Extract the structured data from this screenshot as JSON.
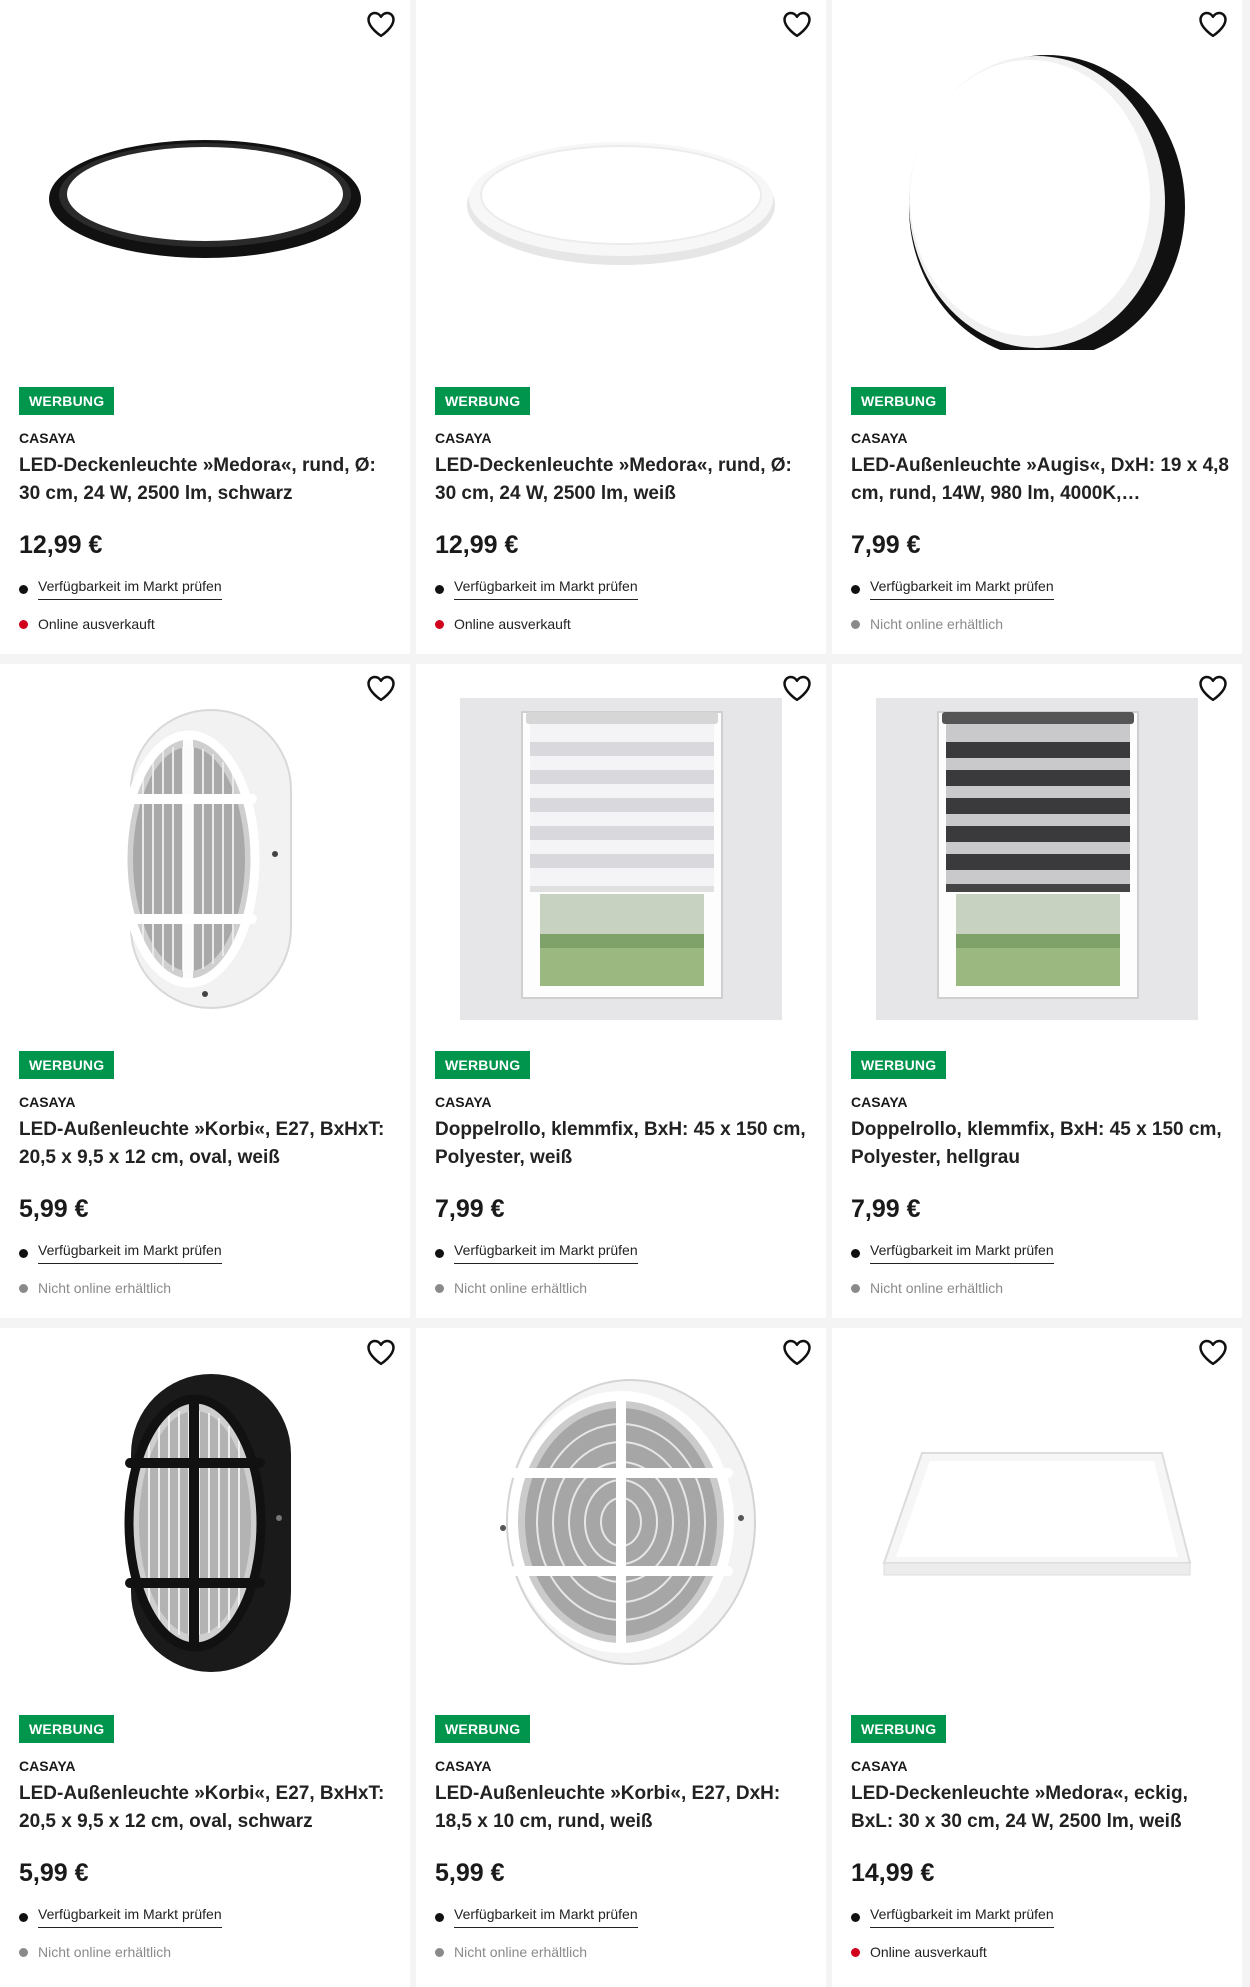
{
  "badge_label": "WERBUNG",
  "availability_link": "Verfügbarkeit im Markt prüfen",
  "colors": {
    "badge": "#00954d",
    "sold_out_dot": "#d0021b",
    "unavailable_dot": "#8a8a8a"
  },
  "products": [
    {
      "brand": "CASAYA",
      "title": "LED-Deckenleuchte »Medora«, rund, Ø: 30 cm, 24 W, 2500 lm, schwarz",
      "price": "12,99 €",
      "stock": "Online ausverkauft",
      "stock_status": "sold-out",
      "image": "round-ceiling-light-black"
    },
    {
      "brand": "CASAYA",
      "title": "LED-Deckenleuchte »Medora«, rund, Ø: 30 cm, 24 W, 2500 lm, weiß",
      "price": "12,99 €",
      "stock": "Online ausverkauft",
      "stock_status": "sold-out",
      "image": "round-ceiling-light-white"
    },
    {
      "brand": "CASAYA",
      "title": "LED-Außenleuchte »Augis«, DxH: 19 x 4,8 cm, rund, 14W, 980 lm, 4000K,…",
      "price": "7,99 €",
      "stock": "Nicht online erhältlich",
      "stock_status": "unavailable",
      "image": "round-outdoor-light"
    },
    {
      "brand": "CASAYA",
      "title": "LED-Außenleuchte »Korbi«, E27, BxHxT: 20,5 x 9,5 x 12 cm, oval, weiß",
      "price": "5,99 €",
      "stock": "Nicht online erhältlich",
      "stock_status": "unavailable",
      "image": "oval-bulkhead-white"
    },
    {
      "brand": "CASAYA",
      "title": "Doppelrollo, klemmfix, BxH: 45 x 150 cm, Polyester, weiß",
      "price": "7,99 €",
      "stock": "Nicht online erhältlich",
      "stock_status": "unavailable",
      "image": "roller-blind-white"
    },
    {
      "brand": "CASAYA",
      "title": "Doppelrollo, klemmfix, BxH: 45 x 150 cm, Polyester, hellgrau",
      "price": "7,99 €",
      "stock": "Nicht online erhältlich",
      "stock_status": "unavailable",
      "image": "roller-blind-grey"
    },
    {
      "brand": "CASAYA",
      "title": "LED-Außenleuchte »Korbi«, E27, BxHxT: 20,5 x 9,5 x 12 cm, oval, schwarz",
      "price": "5,99 €",
      "stock": "Nicht online erhältlich",
      "stock_status": "unavailable",
      "image": "oval-bulkhead-black"
    },
    {
      "brand": "CASAYA",
      "title": "LED-Außenleuchte »Korbi«, E27, DxH: 18,5 x 10 cm, rund, weiß",
      "price": "5,99 €",
      "stock": "Nicht online erhältlich",
      "stock_status": "unavailable",
      "image": "round-bulkhead-white"
    },
    {
      "brand": "CASAYA",
      "title": "LED-Deckenleuchte »Medora«, eckig, BxL: 30 x 30 cm, 24 W, 2500 lm, weiß",
      "price": "14,99 €",
      "stock": "Online ausverkauft",
      "stock_status": "sold-out",
      "image": "square-ceiling-light-white"
    }
  ]
}
